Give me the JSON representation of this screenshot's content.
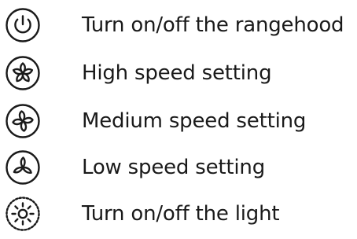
{
  "legend": {
    "items": [
      {
        "icon": "power-icon",
        "label": "Turn on/off the rangehood"
      },
      {
        "icon": "fan-high-speed-icon",
        "label": "High speed setting"
      },
      {
        "icon": "fan-medium-speed-icon",
        "label": "Medium speed setting"
      },
      {
        "icon": "fan-low-speed-icon",
        "label": "Low speed setting"
      },
      {
        "icon": "light-icon",
        "label": "Turn on/off the light"
      }
    ]
  },
  "colors": {
    "text": "#1a1a1a",
    "icon_stroke": "#1a1a1a",
    "background": "#ffffff"
  }
}
